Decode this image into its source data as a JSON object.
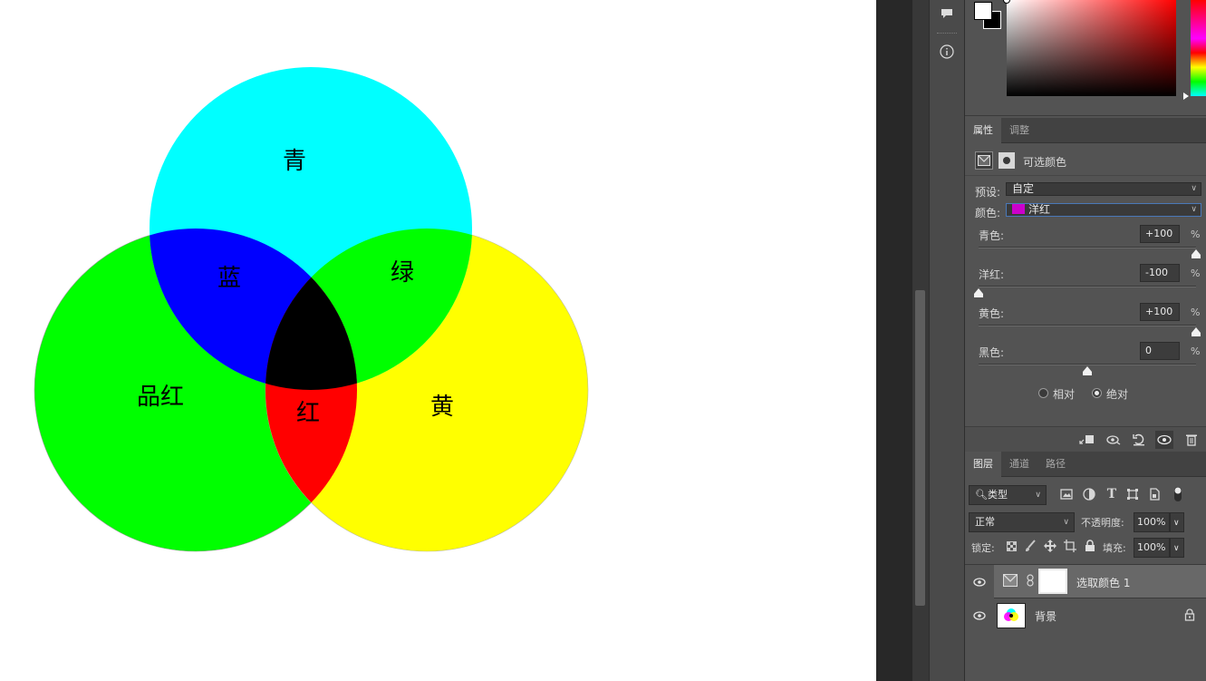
{
  "canvas": {
    "labels": {
      "cyan": "青",
      "blue": "蓝",
      "green": "绿",
      "magenta": "品红",
      "red": "红",
      "yellow": "黄"
    },
    "colors": {
      "cyan": "#00ffff",
      "blue": "#0000ff",
      "green": "#00ff00",
      "magenta_circle": "#00ff00",
      "red": "#ff0000",
      "yellow": "#ffff00",
      "center": "#000000"
    }
  },
  "icon_strip": {
    "icons": [
      "comment-icon",
      "info-icon"
    ]
  },
  "color_picker": {
    "foreground": "#ffffff",
    "background": "#000000",
    "hue": "#ff0000"
  },
  "properties": {
    "tabs": [
      "属性",
      "调整"
    ],
    "active_tab": "属性",
    "title": "可选颜色",
    "preset_label": "预设:",
    "preset_value": "自定",
    "color_label": "颜色:",
    "color_value": "洋红",
    "color_swatch": "#cc00cc",
    "sliders": [
      {
        "label": "青色:",
        "value": "+100",
        "unit": "%",
        "level": 1.0
      },
      {
        "label": "洋红:",
        "value": "-100",
        "unit": "%",
        "level": 0.0
      },
      {
        "label": "黄色:",
        "value": "+100",
        "unit": "%",
        "level": 1.0
      },
      {
        "label": "黑色:",
        "value": "0",
        "unit": "%",
        "level": 0.5
      }
    ],
    "method_options": [
      "相对",
      "绝对"
    ],
    "method_selected": "绝对"
  },
  "layers": {
    "tabs": [
      "图层",
      "通道",
      "路径"
    ],
    "active_tab": "图层",
    "filter_value": "类型",
    "blend_mode": "正常",
    "opacity_label": "不透明度:",
    "opacity_value": "100%",
    "lock_label": "锁定:",
    "fill_label": "填充:",
    "fill_value": "100%",
    "items": [
      {
        "name": "选取颜色 1",
        "selected": true,
        "visible": true
      },
      {
        "name": "背景",
        "selected": false,
        "visible": true,
        "locked": true
      }
    ]
  }
}
